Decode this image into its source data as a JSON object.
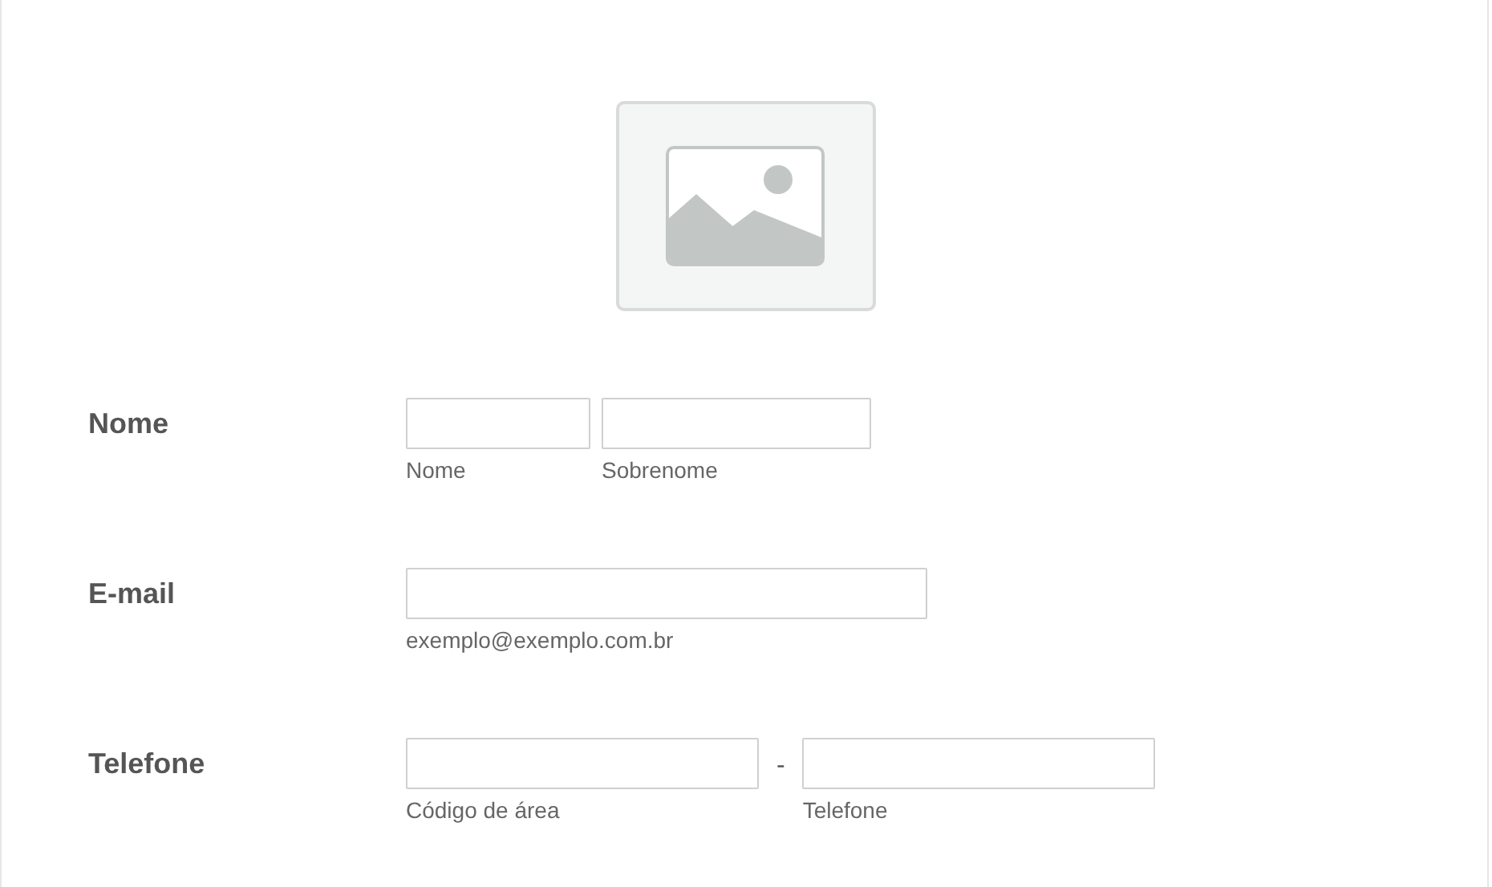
{
  "header_image": {
    "kind": "picture_placeholder"
  },
  "rows": [
    {
      "label": "Nome",
      "fields": [
        {
          "sublabel": "Nome"
        },
        {
          "sublabel": "Sobrenome"
        }
      ]
    },
    {
      "label": "E-mail",
      "fields": [
        {
          "sublabel": "exemplo@exemplo.com.br"
        }
      ]
    },
    {
      "label": "Telefone",
      "separator": "-",
      "fields": [
        {
          "sublabel": "Código de área"
        },
        {
          "sublabel": "Telefone"
        }
      ]
    }
  ]
}
